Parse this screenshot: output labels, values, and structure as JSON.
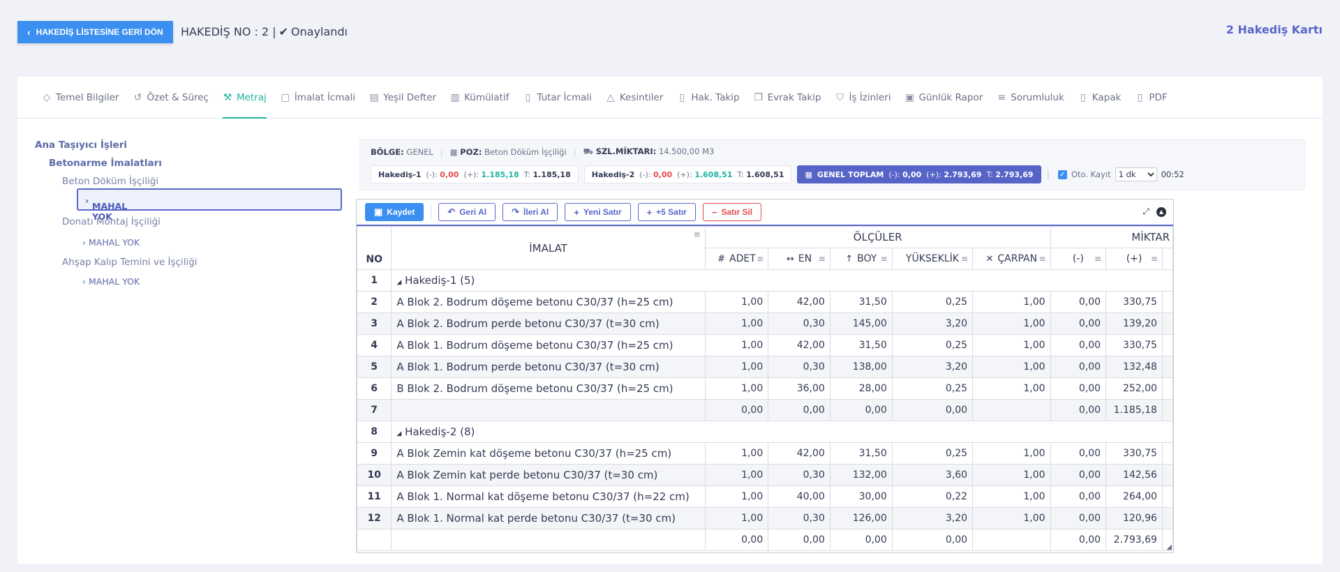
{
  "header": {
    "back_label": "HAKEDİŞ LİSTESİNE GERİ DÖN",
    "title": "HAKEDİŞ NO : 2 |",
    "status": "Onaylandı",
    "card_count": "2 Hakediş Kartı"
  },
  "tabs": [
    {
      "label": "Temel Bilgiler",
      "icon": "tag-icon"
    },
    {
      "label": "Özet & Süreç",
      "icon": "history-icon"
    },
    {
      "label": "Metraj",
      "icon": "hammer-icon"
    },
    {
      "label": "İmalat İcmali",
      "icon": "box-icon"
    },
    {
      "label": "Yeşil Defter",
      "icon": "book-icon"
    },
    {
      "label": "Kümülatif",
      "icon": "bar-chart-icon"
    },
    {
      "label": "Tutar İcmali",
      "icon": "document-icon"
    },
    {
      "label": "Kesintiler",
      "icon": "warning-icon"
    },
    {
      "label": "Hak. Takip",
      "icon": "file-icon"
    },
    {
      "label": "Evrak Takip",
      "icon": "files-icon"
    },
    {
      "label": "İş İzinleri",
      "icon": "shield-icon"
    },
    {
      "label": "Günlük Rapor",
      "icon": "calendar-icon"
    },
    {
      "label": "Sorumluluk",
      "icon": "list-icon"
    },
    {
      "label": "Kapak",
      "icon": "page-icon"
    },
    {
      "label": "PDF",
      "icon": "pdf-icon"
    }
  ],
  "tree": {
    "root": "Ana Taşıyıcı İşleri",
    "group": "Betonarme İmalatları",
    "items": [
      {
        "label": "Beton Döküm İşçiliği",
        "child": "MAHAL YOK"
      },
      {
        "label": "Donatı Montaj İşçiliği",
        "child": "MAHAL YOK"
      },
      {
        "label": "Ahşap Kalıp Temini ve İşçiliği",
        "child": "MAHAL YOK"
      }
    ]
  },
  "info": {
    "bolge_label": "BÖLGE:",
    "bolge": "GENEL",
    "poz_label": "POZ:",
    "poz": "Beton Döküm İşçiliği",
    "szl_label": "SZL.MİKTARI:",
    "szl": "14.500,00 M3",
    "chips": [
      {
        "name": "Hakediş-1",
        "neg_label": "(-):",
        "neg": "0,00",
        "pos_label": "(+):",
        "pos": "1.185,18",
        "t_label": "T:",
        "t": "1.185,18"
      },
      {
        "name": "Hakediş-2",
        "neg_label": "(-):",
        "neg": "0,00",
        "pos_label": "(+):",
        "pos": "1.608,51",
        "t_label": "T:",
        "t": "1.608,51"
      }
    ],
    "total": {
      "name": "GENEL TOPLAM",
      "neg_label": "(-):",
      "neg": "0,00",
      "pos_label": "(+):",
      "pos": "2.793,69",
      "t_label": "T:",
      "t": "2.793,69"
    },
    "oto_label": "Oto. Kayıt",
    "interval": "1 dk",
    "timer": "00:52"
  },
  "toolbar": {
    "save": "Kaydet",
    "undo": "Geri Al",
    "redo": "İleri Al",
    "new_row": "Yeni Satır",
    "add5": "+5 Satır",
    "delete_row": "Satır Sil"
  },
  "columns": {
    "no": "NO",
    "imalat": "İMALAT",
    "olculer": "ÖLÇÜLER",
    "miktar": "MİKTAR",
    "adet": "ADET",
    "en": "EN",
    "boy": "BOY",
    "yukseklik": "YÜKSEKLİK",
    "carpan": "ÇARPAN",
    "neg": "(-)",
    "pos": "(+)"
  },
  "rows": [
    {
      "no": "1",
      "group": "Hakediş-1 (5)"
    },
    {
      "no": "2",
      "imalat": "A Blok 2. Bodrum döşeme betonu C30/37 (h=25 cm)",
      "adet": "1,00",
      "en": "42,00",
      "boy": "31,50",
      "yuk": "0,25",
      "carpan": "1,00",
      "neg": "0,00",
      "pos": "330,75"
    },
    {
      "no": "3",
      "imalat": "A Blok 2. Bodrum perde betonu C30/37 (t=30 cm)",
      "adet": "1,00",
      "en": "0,30",
      "boy": "145,00",
      "yuk": "3,20",
      "carpan": "1,00",
      "neg": "0,00",
      "pos": "139,20"
    },
    {
      "no": "4",
      "imalat": "A Blok 1. Bodrum döşeme betonu C30/37 (h=25 cm)",
      "adet": "1,00",
      "en": "42,00",
      "boy": "31,50",
      "yuk": "0,25",
      "carpan": "1,00",
      "neg": "0,00",
      "pos": "330,75"
    },
    {
      "no": "5",
      "imalat": "A Blok 1. Bodrum perde betonu C30/37 (t=30 cm)",
      "adet": "1,00",
      "en": "0,30",
      "boy": "138,00",
      "yuk": "3,20",
      "carpan": "1,00",
      "neg": "0,00",
      "pos": "132,48"
    },
    {
      "no": "6",
      "imalat": "B Blok 2. Bodrum döşeme betonu C30/37 (h=25 cm)",
      "adet": "1,00",
      "en": "36,00",
      "boy": "28,00",
      "yuk": "0,25",
      "carpan": "1,00",
      "neg": "0,00",
      "pos": "252,00"
    },
    {
      "no": "7",
      "imalat": "",
      "adet": "0,00",
      "en": "0,00",
      "boy": "0,00",
      "yuk": "0,00",
      "carpan": "",
      "neg": "0,00",
      "pos": "1.185,18"
    },
    {
      "no": "8",
      "group": "Hakediş-2 (8)"
    },
    {
      "no": "9",
      "imalat": "A Blok Zemin kat döşeme betonu C30/37 (h=25 cm)",
      "adet": "1,00",
      "en": "42,00",
      "boy": "31,50",
      "yuk": "0,25",
      "carpan": "1,00",
      "neg": "0,00",
      "pos": "330,75"
    },
    {
      "no": "10",
      "imalat": "A Blok Zemin kat perde betonu C30/37 (t=30 cm)",
      "adet": "1,00",
      "en": "0,30",
      "boy": "132,00",
      "yuk": "3,60",
      "carpan": "1,00",
      "neg": "0,00",
      "pos": "142,56"
    },
    {
      "no": "11",
      "imalat": "A Blok 1. Normal kat döşeme betonu C30/37 (h=22 cm)",
      "adet": "1,00",
      "en": "40,00",
      "boy": "30,00",
      "yuk": "0,22",
      "carpan": "1,00",
      "neg": "0,00",
      "pos": "264,00"
    },
    {
      "no": "12",
      "imalat": "A Blok 1. Normal kat perde betonu C30/37 (t=30 cm)",
      "adet": "1,00",
      "en": "0,30",
      "boy": "126,00",
      "yuk": "3,20",
      "carpan": "1,00",
      "neg": "0,00",
      "pos": "120,96"
    },
    {
      "no": "",
      "imalat": "",
      "adet": "0,00",
      "en": "0,00",
      "boy": "0,00",
      "yuk": "0,00",
      "carpan": "",
      "neg": "0,00",
      "pos": "2.793,69"
    }
  ],
  "colors": {
    "accent": "#5867c9",
    "primary": "#3b8ff0",
    "teal": "#20b4a0",
    "danger": "#e14b4b"
  }
}
